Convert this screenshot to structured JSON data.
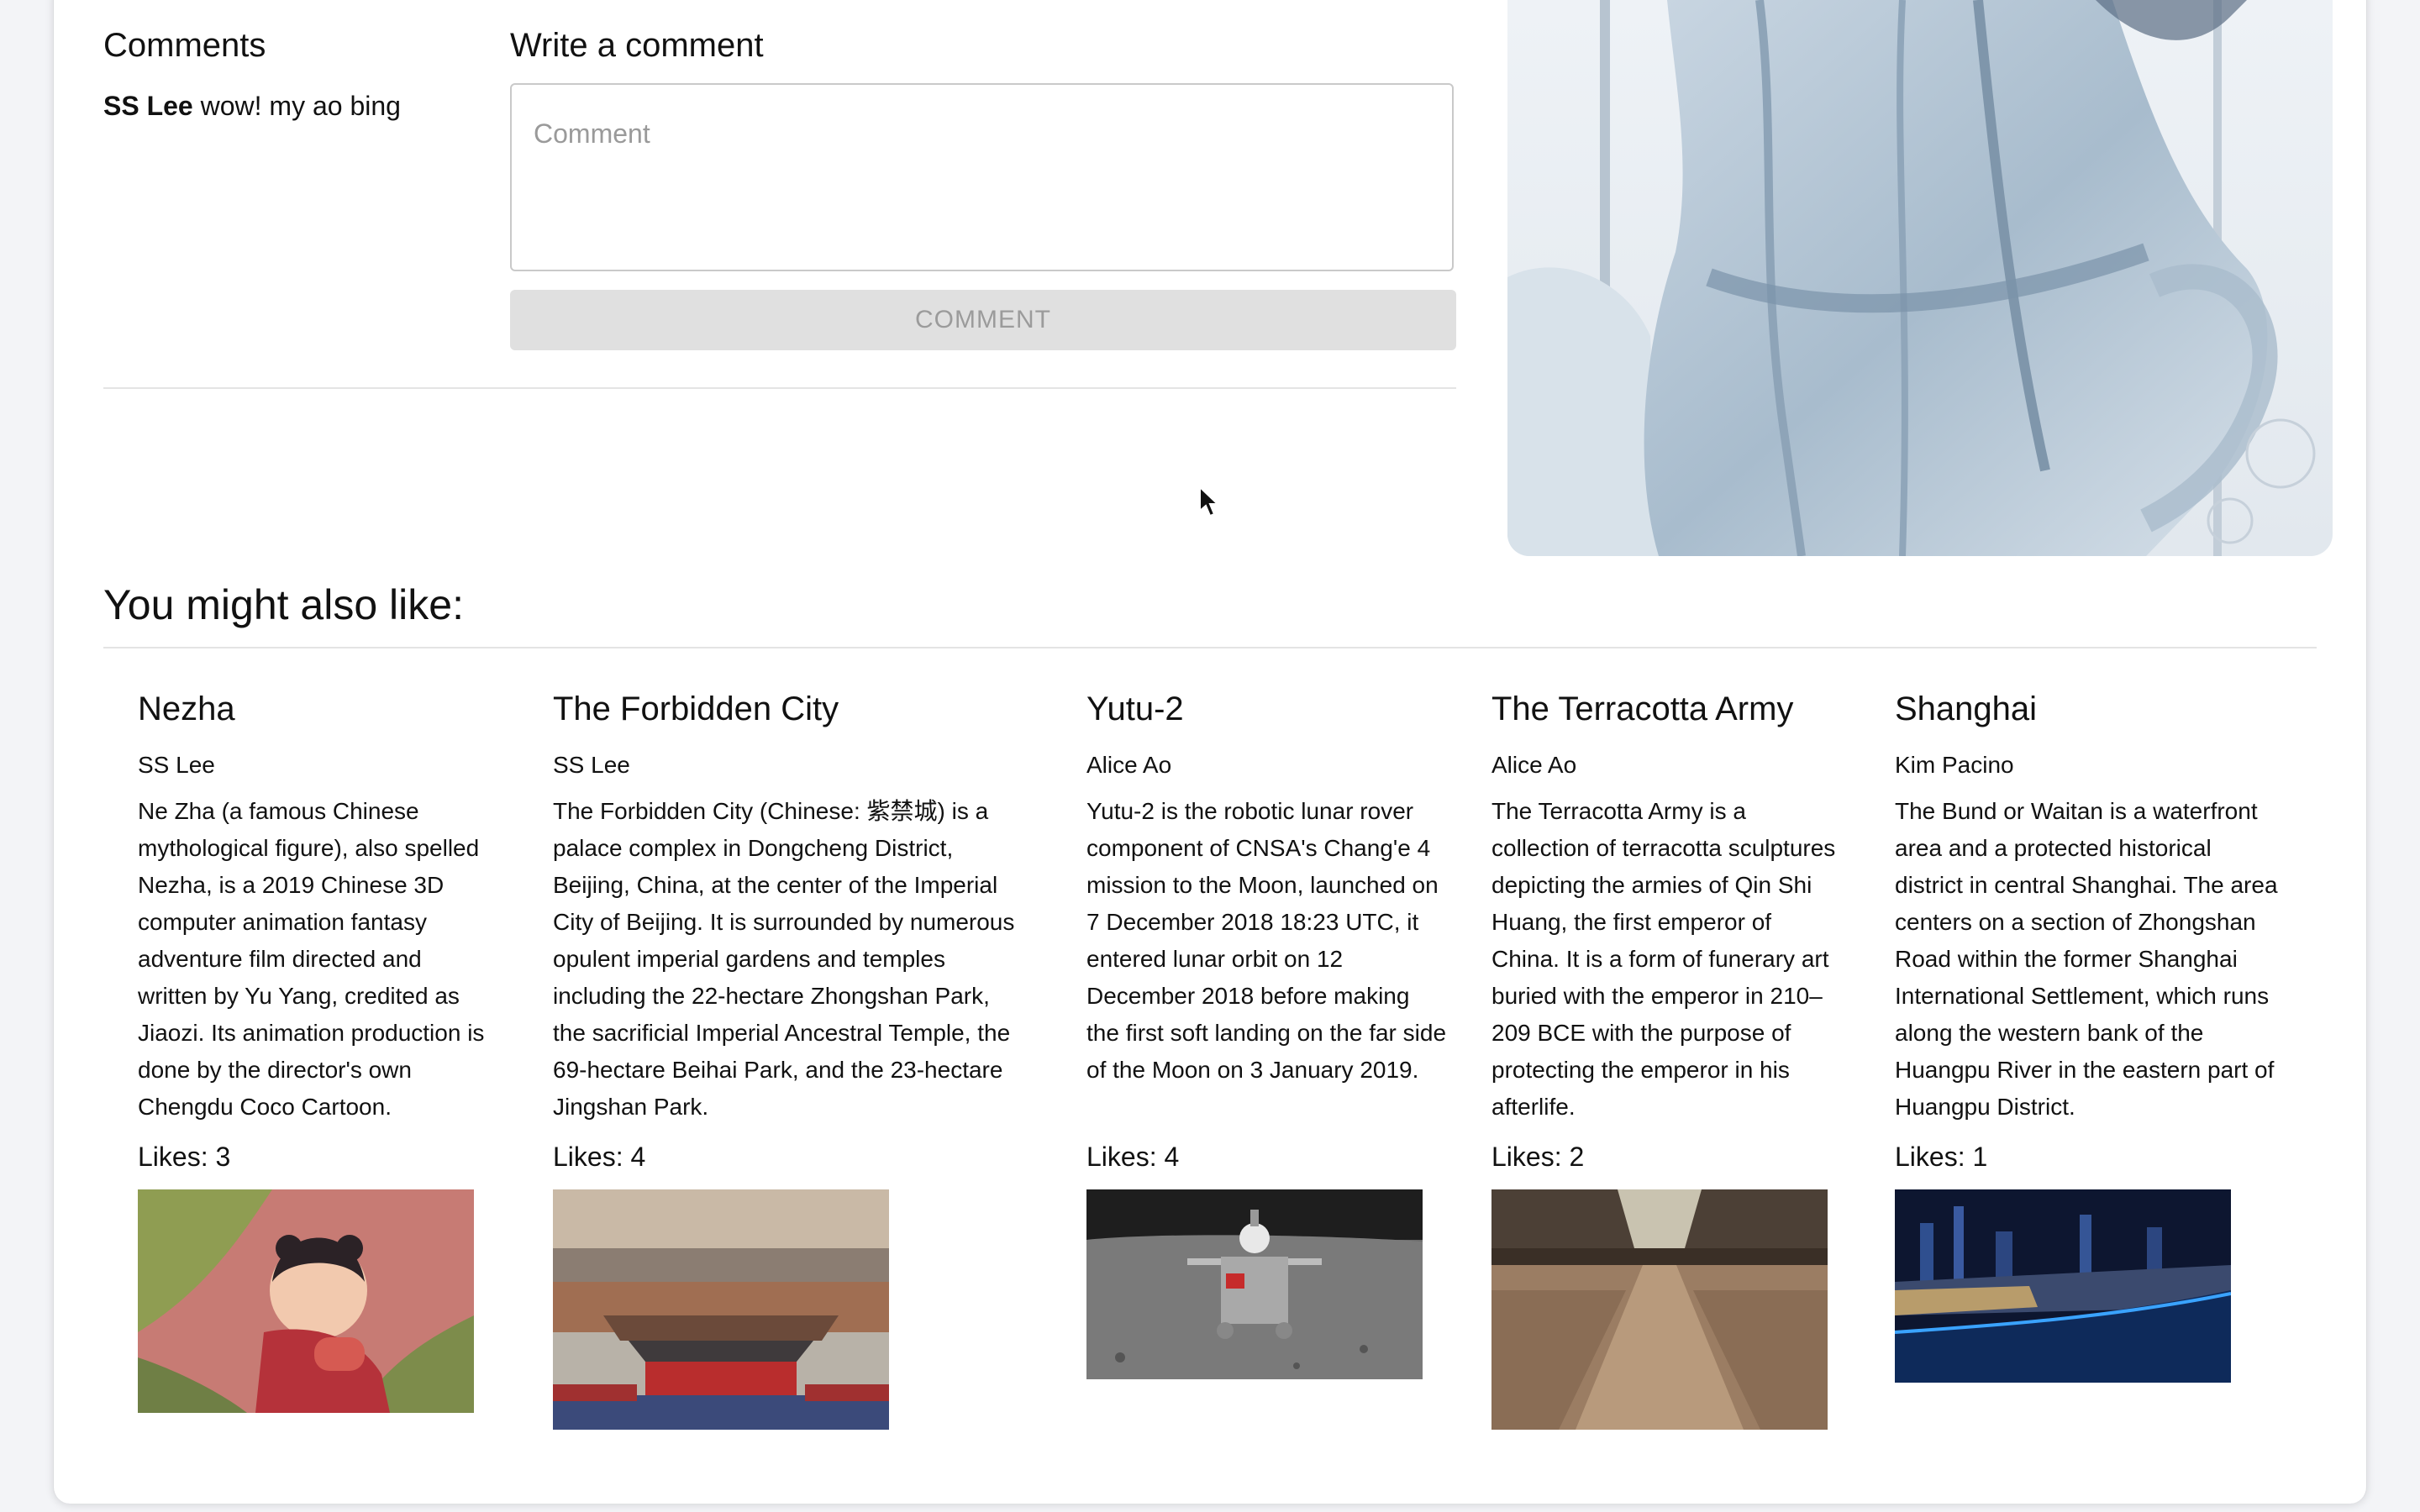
{
  "comments": {
    "heading": "Comments",
    "entries": [
      {
        "author": "SS Lee",
        "text": "wow! my ao bing"
      }
    ]
  },
  "write_comment": {
    "heading": "Write a comment",
    "placeholder": "Comment",
    "button_label": "COMMENT"
  },
  "recommendations": {
    "heading": "You might also like:",
    "likes_prefix": "Likes: ",
    "items": [
      {
        "title": "Nezha",
        "author": "SS Lee",
        "description": "Ne Zha (a famous Chinese mythological figure), also spelled Nezha, is a 2019 Chinese 3D computer animation fantasy adventure film directed and written by Yu Yang, credited as Jiaozi. Its animation production is done by the director's own Chengdu Coco Cartoon.",
        "likes": "3"
      },
      {
        "title": "The Forbidden City",
        "author": "SS Lee",
        "description": "The Forbidden City (Chinese: 紫禁城) is a palace complex in Dongcheng District, Beijing, China, at the center of the Imperial City of Beijing. It is surrounded by numerous opulent imperial gardens and temples including the 22-hectare Zhongshan Park, the sacrificial Imperial Ancestral Temple, the 69-hectare Beihai Park, and the 23-hectare Jingshan Park.",
        "likes": "4"
      },
      {
        "title": "Yutu-2",
        "author": "Alice Ao",
        "description": "Yutu-2 is the robotic lunar rover component of CNSA's Chang'e 4 mission to the Moon, launched on 7 December 2018 18:23 UTC, it entered lunar orbit on 12 December 2018 before making the first soft landing on the far side of the Moon on 3 January 2019.",
        "likes": "4"
      },
      {
        "title": "The Terracotta Army",
        "author": "Alice Ao",
        "description": "The Terracotta Army is a collection of terracotta sculptures depicting the armies of Qin Shi Huang, the first emperor of China. It is a form of funerary art buried with the emperor in 210–209 BCE with the purpose of protecting the emperor in his afterlife.",
        "likes": "2"
      },
      {
        "title": "Shanghai",
        "author": "Kim Pacino",
        "description": "The Bund or Waitan is a waterfront area and a protected historical district in central Shanghai. The area centers on a section of Zhongshan Road within the former Shanghai International Settlement, which runs along the western bank of the Huangpu River in the eastern part of Huangpu District.",
        "likes": "1"
      }
    ]
  }
}
